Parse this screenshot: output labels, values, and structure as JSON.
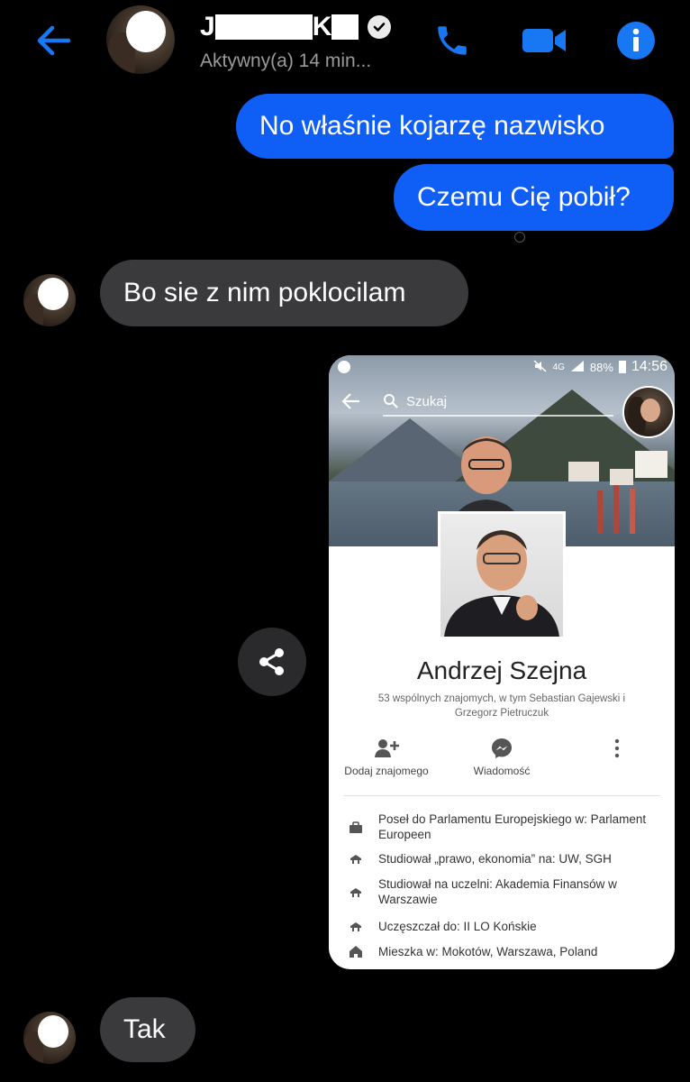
{
  "header": {
    "name_first_initial": "J",
    "name_second_initial": "K",
    "status": "Aktywny(a) 14 min...",
    "colors": {
      "accent": "#1877f2",
      "outgoing": "#0f5ff7",
      "incoming": "#3a3a3c"
    }
  },
  "messages": [
    {
      "dir": "out",
      "text": "No właśnie kojarzę nazwisko"
    },
    {
      "dir": "out",
      "text": "Czemu Cię pobił?"
    },
    {
      "dir": "in",
      "text": "Bo sie z nim poklocilam"
    },
    {
      "dir": "in",
      "text": "Tak"
    }
  ],
  "shared_screenshot": {
    "status_bar": {
      "network": "4G",
      "battery": "88%",
      "time": "14:56"
    },
    "search_placeholder": "Szukaj",
    "profile_name": "Andrzej Szejna",
    "mutual_friends": "53 wspólnych znajomych, w tym Sebastian Gajewski i Grzegorz Pietruczuk",
    "actions": [
      {
        "label": "Dodaj znajomego",
        "icon": "add-friend-icon"
      },
      {
        "label": "Wiadomość",
        "icon": "messenger-icon"
      }
    ],
    "info": [
      {
        "icon": "briefcase-icon",
        "text": "Poseł do Parlamentu Europejskiego w: Parlament Europeen"
      },
      {
        "icon": "graduation-cap-icon",
        "text": "Studiował „prawo, ekonomia” na: UW, SGH"
      },
      {
        "icon": "graduation-cap-icon",
        "text": "Studiował na uczelni: Akademia Finansów w Warszawie"
      },
      {
        "icon": "graduation-cap-icon",
        "text": "Uczęszczał do: II LO Końskie"
      },
      {
        "icon": "home-icon",
        "text": "Mieszka w: Mokotów, Warszawa, Poland"
      }
    ]
  }
}
